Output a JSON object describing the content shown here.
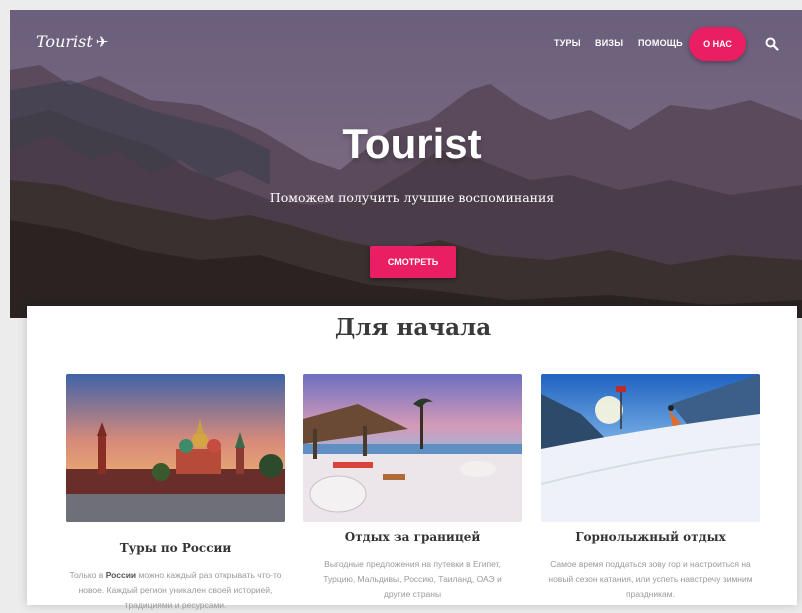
{
  "nav": {
    "logo": "Tourist",
    "links": [
      "ТУРЫ",
      "ВИЗЫ",
      "ПОМОЩЬ"
    ],
    "about": "О НАС"
  },
  "hero": {
    "title": "Tourist",
    "subtitle": "Поможем получить лучшие воспоминания",
    "button": "СМОТРЕТЬ"
  },
  "section": {
    "title": "Для начала",
    "cards": [
      {
        "title": "Туры по России",
        "text_before": "Только в ",
        "text_bold": "России",
        "text_after": " можно каждый раз открывать что-то новое. Каждый регион уникален своей историей, традициями и ресурсами."
      },
      {
        "title": "Отдых за границей",
        "text": "Выгодные предложения на путевки в Египет, Турцию, Мальдивы, Россию, Таиланд, ОАЭ и другие страны"
      },
      {
        "title": "Горнолыжный отдых",
        "text": "Самое время поддаться зову гор и настроиться на новый сезон катания, или успеть навстречу зимним праздникам."
      }
    ]
  },
  "colors": {
    "accent": "#e91e63"
  }
}
